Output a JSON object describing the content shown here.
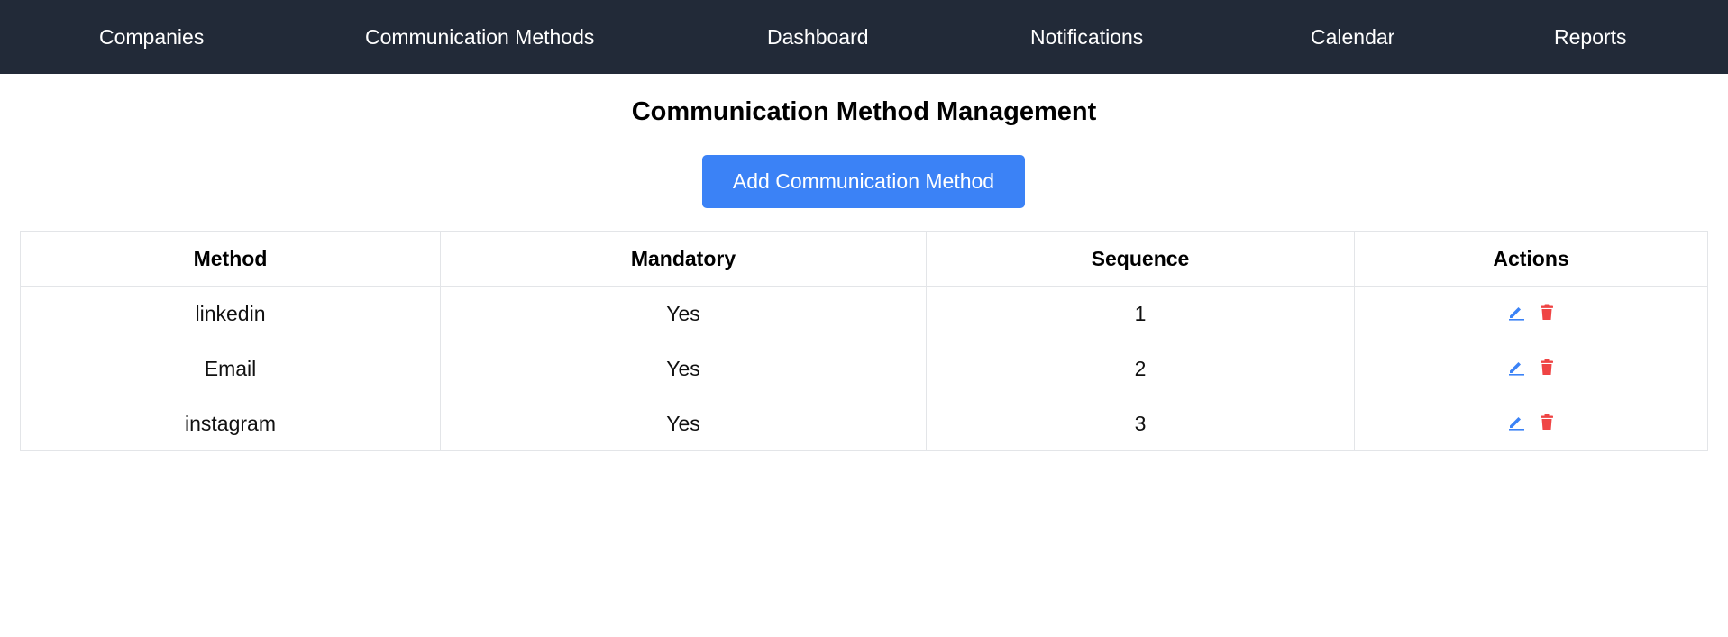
{
  "nav": {
    "items": [
      {
        "label": "Companies"
      },
      {
        "label": "Communication Methods"
      },
      {
        "label": "Dashboard"
      },
      {
        "label": "Notifications"
      },
      {
        "label": "Calendar"
      },
      {
        "label": "Reports"
      }
    ]
  },
  "page": {
    "title": "Communication Method Management",
    "add_button_label": "Add Communication Method"
  },
  "table": {
    "headers": [
      "Method",
      "Mandatory",
      "Sequence",
      "Actions"
    ],
    "rows": [
      {
        "method": "linkedin",
        "mandatory": "Yes",
        "sequence": "1"
      },
      {
        "method": "Email",
        "mandatory": "Yes",
        "sequence": "2"
      },
      {
        "method": "instagram",
        "mandatory": "Yes",
        "sequence": "3"
      }
    ],
    "row_actions": [
      "edit-icon",
      "trash-icon"
    ]
  },
  "colors": {
    "nav_background": "#222a38",
    "primary": "#3b82f6",
    "danger": "#ef4444",
    "border": "#e3e5e8"
  }
}
